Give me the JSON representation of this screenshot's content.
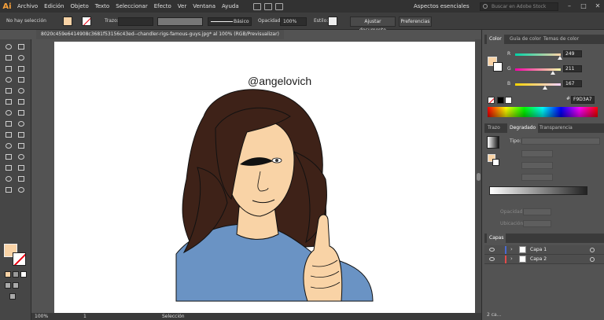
{
  "menubar": {
    "logo": "Ai",
    "items": [
      "Archivo",
      "Edición",
      "Objeto",
      "Texto",
      "Seleccionar",
      "Efecto",
      "Ver",
      "Ventana",
      "Ayuda"
    ],
    "workspace": "Aspectos esenciales",
    "search_placeholder": "Buscar en Adobe Stock",
    "window_controls": [
      "–",
      "□",
      "✕"
    ]
  },
  "controlbar": {
    "selection": "No hay selección",
    "stroke_label": "Trazo:",
    "stroke_style": "Básico",
    "opacity_label": "Opacidad:",
    "opacity_value": "100%",
    "style_label": "Estilo:",
    "fit_doc_button": "Ajustar documento",
    "prefs_button": "Preferencias",
    "fill_color": "#f9d3a6"
  },
  "document": {
    "tab_title": "8020c459e6414908c3681f53156c43ed--chandler-rigs-famous-guys.jpg* al 100% (RGB/Previsualizar)",
    "watermark": "@angelovich"
  },
  "statusbar": {
    "zoom": "100%",
    "artboard": "1",
    "mode": "Selección"
  },
  "color_panel": {
    "tabs": [
      "Color",
      "Guía de color",
      "Temas de color"
    ],
    "channels": [
      {
        "label": "R",
        "value": "249",
        "color": "#e34a4a"
      },
      {
        "label": "G",
        "value": "211",
        "color": "#4ad04a"
      },
      {
        "label": "B",
        "value": "167",
        "color": "#4a6ad0"
      }
    ],
    "levels": [
      0.976,
      0.827,
      0.655
    ],
    "hex_prefix": "#",
    "hex": "F9D3A7"
  },
  "gradient_panel": {
    "tabs": [
      "Trazo",
      "Degradado",
      "Transparencia"
    ],
    "type_label": "Tipo:",
    "opacity_label": "Opacidad:",
    "location_label": "Ubicación:"
  },
  "layers_panel": {
    "title": "Capas",
    "layers": [
      {
        "name": "Capa 1",
        "color": "#4a6ad0"
      },
      {
        "name": "Capa 2",
        "color": "#e34a4a"
      }
    ],
    "footer": "2 ca..."
  },
  "art_colors": {
    "skin": "#f9d3a6",
    "hair": "#3e2218",
    "shirt": "#6a93c4",
    "outline": "#111111"
  }
}
